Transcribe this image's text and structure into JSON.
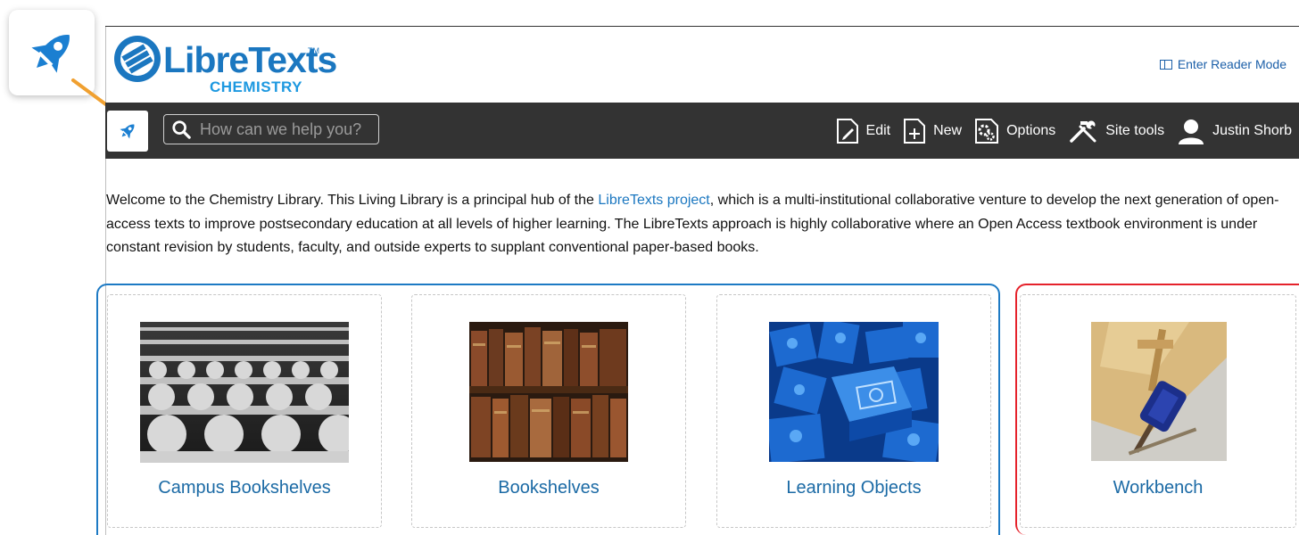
{
  "header": {
    "logo_text": "LibreTexts",
    "logo_tm": "TM",
    "logo_subtitle": "CHEMISTRY",
    "reader_mode_label": "Enter Reader Mode"
  },
  "toolbar": {
    "search_placeholder": "How can we help you?",
    "edit_label": "Edit",
    "new_label": "New",
    "options_label": "Options",
    "site_tools_label": "Site tools",
    "user_label": "Justin Shorb"
  },
  "intro": {
    "before_link": "Welcome to the Chemistry Library. This Living Library is a principal hub of the ",
    "link_text": "LibreTexts project",
    "after_link": ", which is a multi-institutional collaborative venture to develop the next generation of open-access texts to improve postsecondary education at all levels of higher learning. The LibreTexts approach is highly collaborative where an Open Access textbook environment is under constant revision by students, faculty, and outside experts to supplant conventional paper-based books."
  },
  "cards": [
    {
      "label": "Campus Bookshelves"
    },
    {
      "label": "Bookshelves"
    },
    {
      "label": "Learning Objects"
    },
    {
      "label": "Workbench"
    }
  ],
  "colors": {
    "brand_blue": "#1b77c0",
    "toolbar_bg": "#333333",
    "highlight_blue": "#1d7ac4",
    "highlight_red": "#e5222b",
    "accent_orange": "#f0a030"
  },
  "icons": {
    "rocket": "rocket-icon",
    "search": "search-icon",
    "edit": "edit-icon",
    "new": "new-page-icon",
    "options": "gear-icon",
    "site_tools": "tools-icon",
    "user": "user-icon",
    "reader": "reader-mode-icon"
  }
}
